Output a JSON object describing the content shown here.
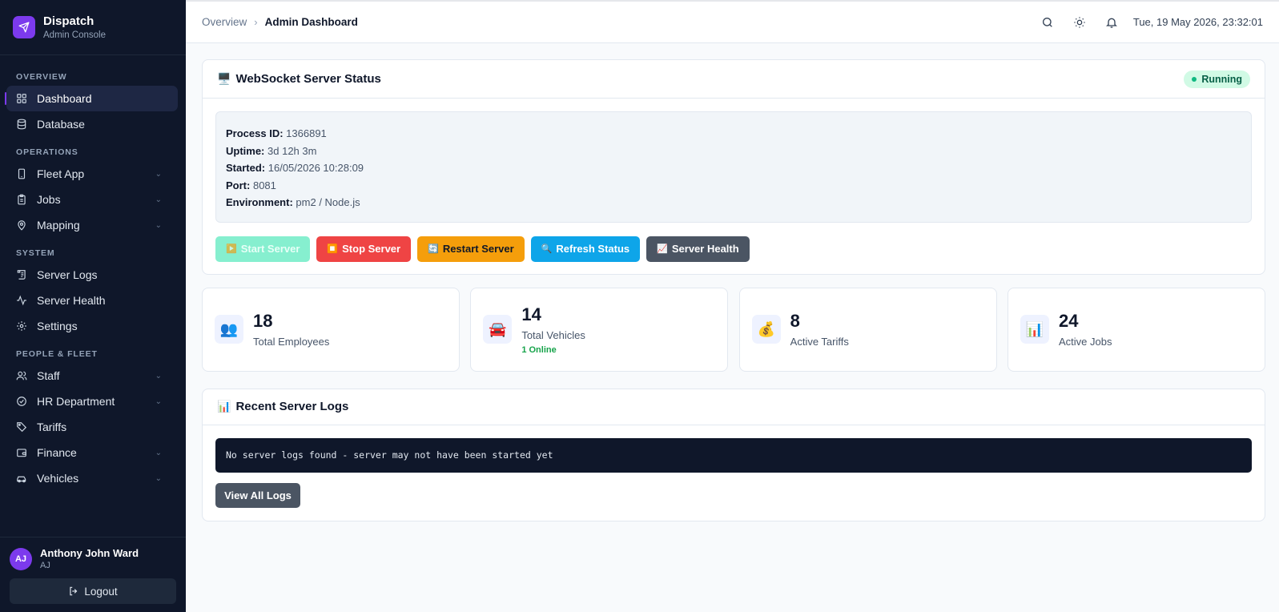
{
  "brand": {
    "name": "Dispatch",
    "subtitle": "Admin Console"
  },
  "sidebar": {
    "sections": [
      {
        "label": "OVERVIEW",
        "items": [
          {
            "label": "Dashboard",
            "icon": "grid-icon",
            "active": true
          },
          {
            "label": "Database",
            "icon": "database-icon"
          }
        ]
      },
      {
        "label": "OPERATIONS",
        "items": [
          {
            "label": "Fleet App",
            "icon": "phone-icon",
            "expandable": true
          },
          {
            "label": "Jobs",
            "icon": "clipboard-icon",
            "expandable": true
          },
          {
            "label": "Mapping",
            "icon": "map-pin-icon",
            "expandable": true
          }
        ]
      },
      {
        "label": "SYSTEM",
        "items": [
          {
            "label": "Server Logs",
            "icon": "scroll-icon"
          },
          {
            "label": "Server Health",
            "icon": "activity-icon"
          },
          {
            "label": "Settings",
            "icon": "gear-icon"
          }
        ]
      },
      {
        "label": "PEOPLE & FLEET",
        "items": [
          {
            "label": "Staff",
            "icon": "users-icon",
            "expandable": true
          },
          {
            "label": "HR Department",
            "icon": "check-circle-icon",
            "expandable": true
          },
          {
            "label": "Tariffs",
            "icon": "tag-icon"
          },
          {
            "label": "Finance",
            "icon": "wallet-icon",
            "expandable": true
          },
          {
            "label": "Vehicles",
            "icon": "car-icon",
            "expandable": true
          }
        ]
      }
    ],
    "user": {
      "name": "Anthony John Ward",
      "initials": "AJ",
      "avatar_text": "AJ"
    },
    "logout_label": "Logout"
  },
  "topbar": {
    "breadcrumb": [
      "Overview",
      "Admin Dashboard"
    ],
    "datetime": "Tue, 19 May 2026, 23:32:01"
  },
  "server_status": {
    "title": "WebSocket Server Status",
    "title_icon": "🖥️",
    "status": "Running",
    "info": [
      {
        "key": "Process ID:",
        "value": "1366891"
      },
      {
        "key": "Uptime:",
        "value": "3d 12h 3m"
      },
      {
        "key": "Started:",
        "value": "16/05/2026 10:28:09"
      },
      {
        "key": "Port:",
        "value": "8081"
      },
      {
        "key": "Environment:",
        "value": "pm2 / Node.js"
      }
    ],
    "buttons": [
      {
        "label": "Start Server",
        "icon": "▶️",
        "style": "btn-start"
      },
      {
        "label": "Stop Server",
        "icon": "⏹️",
        "style": "btn-stop"
      },
      {
        "label": "Restart Server",
        "icon": "🔄",
        "style": "btn-restart"
      },
      {
        "label": "Refresh Status",
        "icon": "🔍",
        "style": "btn-refresh"
      },
      {
        "label": "Server Health",
        "icon": "📈",
        "style": "btn-health"
      }
    ]
  },
  "stats": [
    {
      "icon": "👥",
      "value": "18",
      "label": "Total Employees",
      "sub": ""
    },
    {
      "icon": "🚘",
      "value": "14",
      "label": "Total Vehicles",
      "sub": "1 Online"
    },
    {
      "icon": "💰",
      "value": "8",
      "label": "Active Tariffs",
      "sub": ""
    },
    {
      "icon": "📊",
      "value": "24",
      "label": "Active Jobs",
      "sub": ""
    }
  ],
  "logs": {
    "title": "Recent Server Logs",
    "title_icon": "📊",
    "message": "No server logs found - server may not have been started yet",
    "view_all_label": "View All Logs"
  },
  "colors": {
    "accent": "#7c3aed",
    "sidebar_bg": "#0f172a",
    "running_bg": "#d1fae5",
    "stop": "#ef4444",
    "restart": "#f59e0b",
    "refresh": "#0ea5e9",
    "online": "#16a34a"
  }
}
